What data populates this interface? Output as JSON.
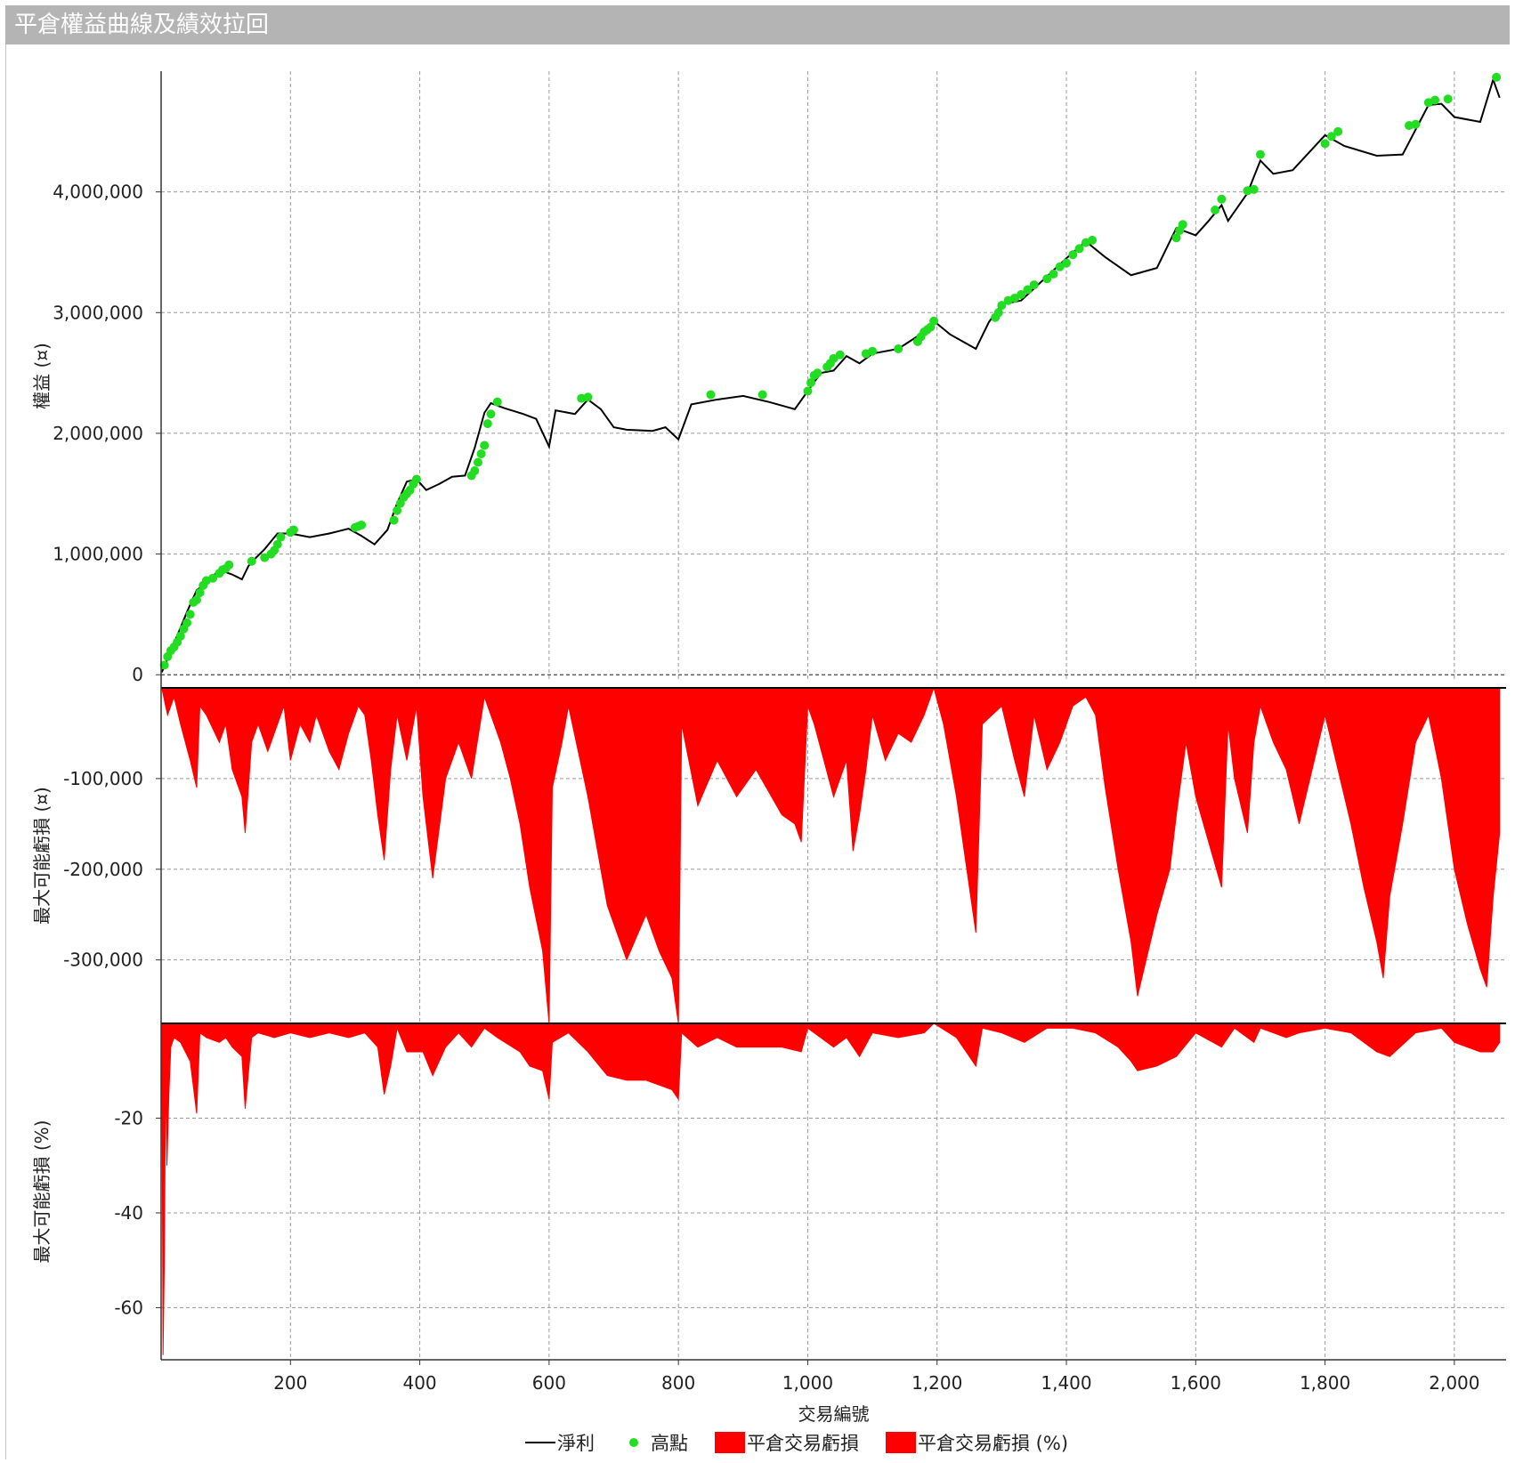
{
  "window": {
    "title": "平倉權益曲線及績效拉回"
  },
  "chart_data": [
    {
      "type": "line",
      "panel": "equity",
      "ylabel": "權益 (¤)",
      "ylim": [
        -50000,
        5000000
      ],
      "yticks": [
        0,
        1000000,
        2000000,
        3000000,
        4000000
      ],
      "ytick_labels": [
        "0",
        "1,000,000",
        "2,000,000",
        "3,000,000",
        "4,000,000"
      ],
      "grid": true,
      "series": [
        {
          "name": "淨利",
          "color": "#000000",
          "x": [
            1,
            20,
            40,
            55,
            70,
            90,
            110,
            125,
            135,
            145,
            160,
            180,
            200,
            230,
            260,
            290,
            310,
            330,
            350,
            365,
            380,
            395,
            410,
            430,
            450,
            470,
            485,
            500,
            510,
            530,
            560,
            580,
            600,
            610,
            640,
            660,
            680,
            700,
            720,
            760,
            780,
            800,
            820,
            860,
            900,
            940,
            980,
            1000,
            1020,
            1040,
            1060,
            1080,
            1100,
            1140,
            1180,
            1195,
            1220,
            1260,
            1280,
            1300,
            1330,
            1360,
            1400,
            1430,
            1460,
            1500,
            1540,
            1570,
            1600,
            1620,
            1640,
            1650,
            1680,
            1700,
            1720,
            1750,
            1800,
            1830,
            1880,
            1920,
            1960,
            1980,
            2000,
            2040,
            2060,
            2070
          ],
          "values": [
            20000,
            260000,
            520000,
            700000,
            760000,
            870000,
            830000,
            790000,
            900000,
            960000,
            1040000,
            1170000,
            1170000,
            1140000,
            1170000,
            1210000,
            1150000,
            1080000,
            1200000,
            1420000,
            1600000,
            1620000,
            1530000,
            1580000,
            1640000,
            1650000,
            1880000,
            2170000,
            2250000,
            2210000,
            2160000,
            2120000,
            1890000,
            2190000,
            2160000,
            2280000,
            2200000,
            2050000,
            2030000,
            2020000,
            2050000,
            1950000,
            2240000,
            2280000,
            2310000,
            2260000,
            2200000,
            2350000,
            2500000,
            2520000,
            2640000,
            2580000,
            2660000,
            2700000,
            2840000,
            2930000,
            2820000,
            2700000,
            2920000,
            3070000,
            3100000,
            3250000,
            3450000,
            3590000,
            3460000,
            3310000,
            3370000,
            3700000,
            3640000,
            3760000,
            3890000,
            3760000,
            3990000,
            4260000,
            4150000,
            4180000,
            4470000,
            4380000,
            4300000,
            4310000,
            4720000,
            4730000,
            4620000,
            4580000,
            4930000,
            4780000
          ]
        },
        {
          "name": "高點",
          "color": "#22dd22",
          "x": [
            5,
            10,
            15,
            20,
            25,
            30,
            35,
            40,
            45,
            50,
            55,
            60,
            65,
            70,
            80,
            90,
            95,
            100,
            105,
            140,
            160,
            170,
            175,
            180,
            185,
            200,
            205,
            300,
            305,
            310,
            360,
            365,
            370,
            375,
            380,
            385,
            390,
            395,
            480,
            485,
            490,
            495,
            500,
            505,
            510,
            520,
            650,
            660,
            850,
            930,
            1000,
            1005,
            1010,
            1015,
            1030,
            1035,
            1040,
            1050,
            1090,
            1100,
            1140,
            1170,
            1175,
            1180,
            1185,
            1190,
            1195,
            1290,
            1295,
            1300,
            1310,
            1320,
            1330,
            1340,
            1350,
            1370,
            1380,
            1390,
            1400,
            1410,
            1420,
            1430,
            1440,
            1570,
            1575,
            1580,
            1630,
            1640,
            1680,
            1690,
            1700,
            1800,
            1810,
            1820,
            1930,
            1940,
            1960,
            1970,
            1990,
            2065
          ],
          "values": [
            80000,
            150000,
            200000,
            230000,
            270000,
            320000,
            380000,
            430000,
            500000,
            600000,
            620000,
            680000,
            740000,
            780000,
            800000,
            840000,
            870000,
            880000,
            910000,
            940000,
            970000,
            1000000,
            1030000,
            1080000,
            1140000,
            1180000,
            1200000,
            1220000,
            1230000,
            1240000,
            1280000,
            1360000,
            1420000,
            1470000,
            1500000,
            1530000,
            1580000,
            1620000,
            1650000,
            1690000,
            1760000,
            1830000,
            1900000,
            2080000,
            2160000,
            2260000,
            2290000,
            2300000,
            2320000,
            2320000,
            2350000,
            2420000,
            2480000,
            2500000,
            2550000,
            2580000,
            2620000,
            2650000,
            2660000,
            2680000,
            2700000,
            2760000,
            2800000,
            2840000,
            2860000,
            2880000,
            2930000,
            2960000,
            3000000,
            3060000,
            3100000,
            3120000,
            3150000,
            3190000,
            3230000,
            3280000,
            3320000,
            3380000,
            3410000,
            3480000,
            3530000,
            3580000,
            3600000,
            3620000,
            3680000,
            3730000,
            3850000,
            3940000,
            4010000,
            4020000,
            4310000,
            4400000,
            4460000,
            4500000,
            4550000,
            4560000,
            4740000,
            4760000,
            4770000,
            4950000
          ]
        }
      ]
    },
    {
      "type": "area",
      "panel": "drawdown_value",
      "ylabel": "最大可能虧損 (¤)",
      "ylim": [
        -370000,
        0
      ],
      "yticks": [
        -100000,
        -200000,
        -300000
      ],
      "ytick_labels": [
        "-100,000",
        "-200,000",
        "-300,000"
      ],
      "grid": true,
      "series": [
        {
          "name": "平倉交易虧損",
          "color": "#ff0000",
          "x": [
            1,
            10,
            20,
            30,
            45,
            55,
            60,
            70,
            90,
            100,
            110,
            125,
            130,
            140,
            150,
            165,
            175,
            190,
            200,
            215,
            230,
            240,
            260,
            275,
            290,
            305,
            315,
            325,
            335,
            345,
            355,
            365,
            380,
            395,
            405,
            420,
            440,
            460,
            480,
            500,
            510,
            525,
            540,
            555,
            570,
            590,
            600,
            605,
            620,
            630,
            660,
            690,
            720,
            750,
            770,
            790,
            800,
            805,
            830,
            860,
            890,
            920,
            960,
            980,
            990,
            1000,
            1010,
            1040,
            1060,
            1070,
            1080,
            1090,
            1100,
            1120,
            1140,
            1160,
            1180,
            1195,
            1210,
            1230,
            1250,
            1260,
            1270,
            1285,
            1300,
            1320,
            1335,
            1350,
            1370,
            1390,
            1410,
            1430,
            1445,
            1460,
            1480,
            1500,
            1510,
            1520,
            1540,
            1560,
            1570,
            1585,
            1600,
            1620,
            1640,
            1650,
            1660,
            1680,
            1690,
            1700,
            1720,
            1740,
            1760,
            1780,
            1800,
            1820,
            1840,
            1860,
            1880,
            1890,
            1900,
            1920,
            1940,
            1960,
            1980,
            2000,
            2020,
            2040,
            2050,
            2060,
            2070
          ],
          "values": [
            0,
            -30000,
            -10000,
            -40000,
            -80000,
            -110000,
            -20000,
            -30000,
            -60000,
            -40000,
            -90000,
            -120000,
            -160000,
            -60000,
            -40000,
            -70000,
            -50000,
            -20000,
            -80000,
            -40000,
            -60000,
            -30000,
            -70000,
            -90000,
            -50000,
            -20000,
            -30000,
            -80000,
            -140000,
            -190000,
            -90000,
            -30000,
            -80000,
            -20000,
            -120000,
            -210000,
            -100000,
            -60000,
            -100000,
            -10000,
            -30000,
            -60000,
            -100000,
            -150000,
            -220000,
            -290000,
            -370000,
            -110000,
            -60000,
            -20000,
            -120000,
            -240000,
            -300000,
            -250000,
            -290000,
            -320000,
            -370000,
            -40000,
            -130000,
            -80000,
            -120000,
            -90000,
            -140000,
            -150000,
            -170000,
            -20000,
            -40000,
            -120000,
            -80000,
            -180000,
            -140000,
            -90000,
            -30000,
            -80000,
            -50000,
            -60000,
            -30000,
            0,
            -40000,
            -120000,
            -220000,
            -270000,
            -40000,
            -30000,
            -20000,
            -80000,
            -120000,
            -30000,
            -90000,
            -60000,
            -20000,
            -10000,
            -30000,
            -110000,
            -200000,
            -280000,
            -340000,
            -310000,
            -250000,
            -200000,
            -140000,
            -60000,
            -120000,
            -170000,
            -220000,
            -40000,
            -100000,
            -160000,
            -60000,
            -20000,
            -60000,
            -90000,
            -150000,
            -90000,
            -30000,
            -90000,
            -150000,
            -220000,
            -280000,
            -320000,
            -230000,
            -150000,
            -60000,
            -30000,
            -100000,
            -200000,
            -260000,
            -310000,
            -330000,
            -230000,
            -160000
          ]
        }
      ]
    },
    {
      "type": "area",
      "panel": "drawdown_percent",
      "ylabel": "最大可能虧損 (%)",
      "xlabel": "交易編號",
      "xlim": [
        0,
        2080
      ],
      "xticks": [
        200,
        400,
        600,
        800,
        1000,
        1200,
        1400,
        1600,
        1800,
        2000
      ],
      "xtick_labels": [
        "200",
        "400",
        "600",
        "800",
        "1,000",
        "1,200",
        "1,400",
        "1,600",
        "1,800",
        "2,000"
      ],
      "ylim": [
        -71,
        0
      ],
      "yticks": [
        -20,
        -40,
        -60
      ],
      "ytick_labels": [
        "-20",
        "-40",
        "-60"
      ],
      "grid": true,
      "series": [
        {
          "name": "平倉交易虧損 (%)",
          "color": "#ff0000",
          "x": [
            1,
            3,
            5,
            7,
            9,
            12,
            15,
            20,
            30,
            45,
            55,
            60,
            70,
            90,
            100,
            110,
            125,
            130,
            140,
            150,
            175,
            200,
            230,
            260,
            290,
            315,
            335,
            345,
            355,
            365,
            380,
            405,
            420,
            440,
            460,
            480,
            500,
            520,
            555,
            570,
            590,
            600,
            605,
            630,
            660,
            690,
            720,
            750,
            790,
            800,
            805,
            830,
            860,
            890,
            960,
            990,
            1000,
            1040,
            1060,
            1080,
            1100,
            1140,
            1180,
            1195,
            1230,
            1260,
            1270,
            1300,
            1335,
            1370,
            1410,
            1445,
            1480,
            1500,
            1510,
            1540,
            1570,
            1600,
            1640,
            1660,
            1690,
            1700,
            1740,
            1760,
            1800,
            1840,
            1880,
            1900,
            1940,
            1980,
            2000,
            2040,
            2060,
            2070
          ],
          "values": [
            0,
            -70,
            -50,
            -10,
            -30,
            -15,
            -5,
            -3,
            -4,
            -8,
            -19,
            -2,
            -3,
            -4,
            -3,
            -5,
            -7,
            -18,
            -3,
            -2,
            -3,
            -2,
            -3,
            -2,
            -3,
            -2,
            -5,
            -15,
            -9,
            -1,
            -6,
            -6,
            -11,
            -5,
            -2,
            -5,
            -1,
            -3,
            -6,
            -9,
            -10,
            -16,
            -4,
            -2,
            -6,
            -11,
            -12,
            -12,
            -14,
            -16,
            -2,
            -5,
            -3,
            -5,
            -5,
            -6,
            -1,
            -5,
            -3,
            -7,
            -2,
            -3,
            -2,
            0,
            -3,
            -9,
            -1,
            -2,
            -4,
            -1,
            -1,
            -2,
            -5,
            -8,
            -10,
            -9,
            -7,
            -2,
            -5,
            -1,
            -4,
            -1,
            -3,
            -2,
            -1,
            -2,
            -6,
            -7,
            -2,
            -1,
            -4,
            -6,
            -6,
            -4
          ]
        }
      ]
    }
  ],
  "legend": {
    "items": [
      {
        "label": "淨利",
        "kind": "line",
        "color": "#000000"
      },
      {
        "label": "高點",
        "kind": "dot",
        "color": "#22dd22"
      },
      {
        "label": "平倉交易虧損",
        "kind": "box",
        "color": "#ff0000"
      },
      {
        "label": "平倉交易虧損 (%)",
        "kind": "box",
        "color": "#ff0000"
      }
    ]
  }
}
